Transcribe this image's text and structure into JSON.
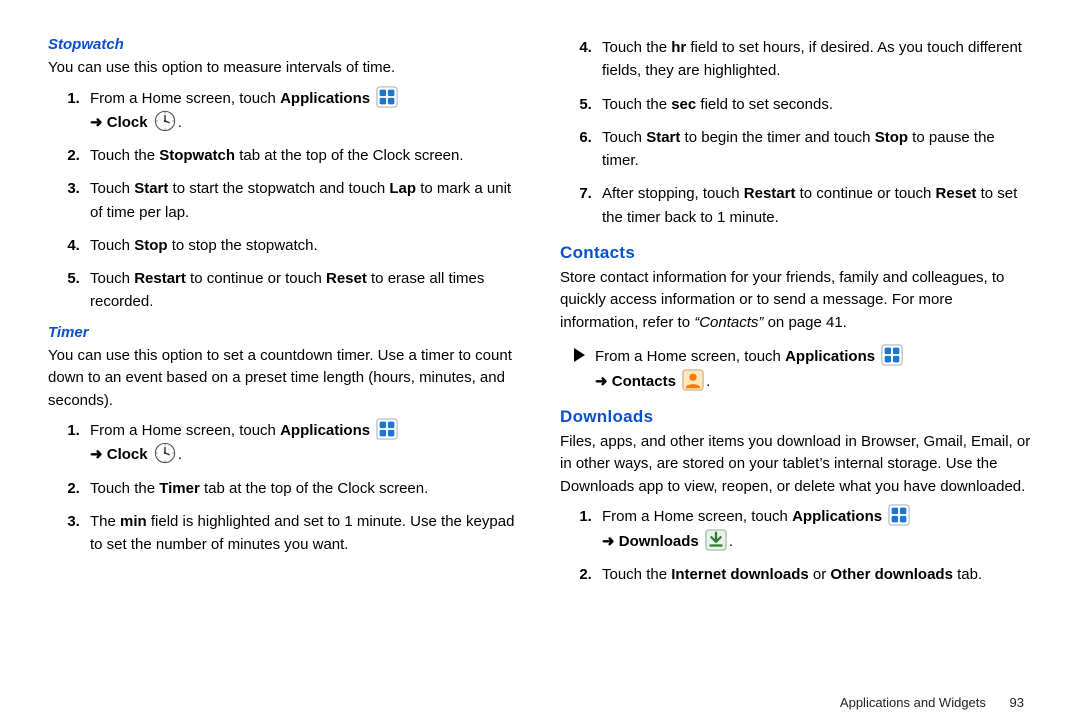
{
  "left": {
    "stopwatch": {
      "heading": "Stopwatch",
      "intro": "You can use this option to measure intervals of time.",
      "steps": {
        "s1a": "From a Home screen, touch ",
        "s1b": "Applications",
        "s1c": " Clock ",
        "s2a": "Touch the ",
        "s2b": "Stopwatch",
        "s2c": " tab at the top of the Clock screen.",
        "s3a": "Touch ",
        "s3b": "Start",
        "s3c": " to start the stopwatch and touch ",
        "s3d": "Lap",
        "s3e": " to mark a unit of time per lap.",
        "s4a": "Touch ",
        "s4b": "Stop",
        "s4c": " to stop the stopwatch.",
        "s5a": "Touch ",
        "s5b": "Restart",
        "s5c": " to continue or touch ",
        "s5d": "Reset",
        "s5e": " to erase all times recorded."
      }
    },
    "timer": {
      "heading": "Timer",
      "intro": "You can use this option to set a countdown timer. Use a timer to count down to an event based on a preset time length (hours, minutes, and seconds).",
      "steps": {
        "s1a": "From a Home screen, touch ",
        "s1b": "Applications",
        "s1c": " Clock ",
        "s2a": "Touch the ",
        "s2b": "Timer",
        "s2c": " tab at the top of the Clock screen.",
        "s3a": "The ",
        "s3b": "min",
        "s3c": " field is highlighted and set to 1 minute. Use the keypad to set the number of minutes you want."
      }
    }
  },
  "right": {
    "cont_steps": {
      "s4a": "Touch the ",
      "s4b": "hr",
      "s4c": " field to set hours, if desired. As you touch different fields, they are highlighted.",
      "s5a": "Touch the ",
      "s5b": "sec",
      "s5c": " field to set seconds.",
      "s6a": "Touch ",
      "s6b": "Start",
      "s6c": " to begin the timer and touch ",
      "s6d": "Stop",
      "s6e": " to pause the timer.",
      "s7a": "After stopping, touch ",
      "s7b": "Restart",
      "s7c": " to continue or touch ",
      "s7d": "Reset",
      "s7e": " to set the timer back to 1 minute."
    },
    "contacts": {
      "heading": "Contacts",
      "intro_a": "Store contact information for your friends, family and colleagues, to quickly access information or to send a message. For more information, refer to ",
      "intro_ref": "“Contacts”",
      "intro_b": "  on page 41.",
      "bullet_a": "From a Home screen, touch ",
      "bullet_b": "Applications",
      "bullet_c": " Contacts "
    },
    "downloads": {
      "heading": "Downloads",
      "intro": "Files, apps, and other items you download in Browser, Gmail, Email, or in other ways, are stored on your tablet’s internal storage. Use the Downloads app to view, reopen, or delete what you have downloaded.",
      "steps": {
        "s1a": "From a Home screen, touch ",
        "s1b": "Applications",
        "s1c": " Downloads ",
        "s2a": "Touch the ",
        "s2b": "Internet downloads",
        "s2c": " or ",
        "s2d": "Other downloads",
        "s2e": " tab."
      }
    }
  },
  "footer": {
    "section": "Applications and Widgets",
    "page": "93"
  },
  "arrow": "➜"
}
